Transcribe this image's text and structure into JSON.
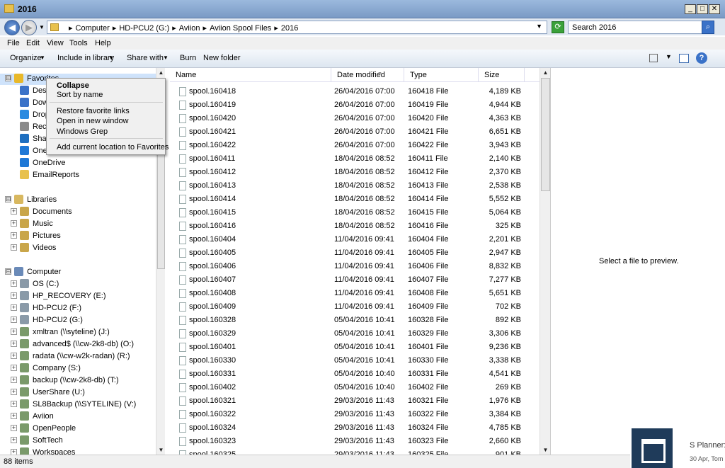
{
  "window": {
    "title": "2016"
  },
  "address": {
    "crumbs": [
      "Computer",
      "HD-PCU2 (G:)",
      "Aviion",
      "Aviion Spool Files",
      "2016"
    ],
    "search_placeholder": "Search 2016"
  },
  "menu": [
    "File",
    "Edit",
    "View",
    "Tools",
    "Help"
  ],
  "toolbar": [
    "Organize",
    "Include in library",
    "Share with",
    "Burn",
    "New folder"
  ],
  "nav": {
    "favorites": {
      "label": "Favorites",
      "items": [
        "Desktop",
        "Downloads",
        "Dropbox",
        "Recent Places",
        "SharePoint",
        "OneDrive",
        "OneDrive",
        "EmailReports"
      ]
    },
    "libraries": {
      "label": "Libraries",
      "items": [
        "Documents",
        "Music",
        "Pictures",
        "Videos"
      ]
    },
    "computer": {
      "label": "Computer",
      "items": [
        "OS (C:)",
        "HP_RECOVERY (E:)",
        "HD-PCU2 (F:)",
        "HD-PCU2 (G:)",
        "xmltran (\\\\syteline) (J:)",
        "advanced$ (\\\\cw-2k8-db) (O:)",
        "radata (\\\\cw-w2k-radan) (R:)",
        "Company (S:)",
        "backup (\\\\cw-2k8-db) (T:)",
        "UserShare (U:)",
        "SL8Backup (\\\\SYTELINE) (V:)",
        "Aviion",
        "OpenPeople",
        "SoftTech",
        "Workspaces"
      ]
    }
  },
  "context_menu": [
    "Collapse",
    "Sort by name",
    "Restore favorite links",
    "Open in new window",
    "Windows Grep",
    "Add current location to Favorites"
  ],
  "columns": [
    "Name",
    "Date modified",
    "Type",
    "Size"
  ],
  "files": [
    {
      "name": "spool.160418",
      "date": "26/04/2016 07:00",
      "type": "160418 File",
      "size": "4,189 KB"
    },
    {
      "name": "spool.160419",
      "date": "26/04/2016 07:00",
      "type": "160419 File",
      "size": "4,944 KB"
    },
    {
      "name": "spool.160420",
      "date": "26/04/2016 07:00",
      "type": "160420 File",
      "size": "4,363 KB"
    },
    {
      "name": "spool.160421",
      "date": "26/04/2016 07:00",
      "type": "160421 File",
      "size": "6,651 KB"
    },
    {
      "name": "spool.160422",
      "date": "26/04/2016 07:00",
      "type": "160422 File",
      "size": "3,943 KB"
    },
    {
      "name": "spool.160411",
      "date": "18/04/2016 08:52",
      "type": "160411 File",
      "size": "2,140 KB"
    },
    {
      "name": "spool.160412",
      "date": "18/04/2016 08:52",
      "type": "160412 File",
      "size": "2,370 KB"
    },
    {
      "name": "spool.160413",
      "date": "18/04/2016 08:52",
      "type": "160413 File",
      "size": "2,538 KB"
    },
    {
      "name": "spool.160414",
      "date": "18/04/2016 08:52",
      "type": "160414 File",
      "size": "5,552 KB"
    },
    {
      "name": "spool.160415",
      "date": "18/04/2016 08:52",
      "type": "160415 File",
      "size": "5,064 KB"
    },
    {
      "name": "spool.160416",
      "date": "18/04/2016 08:52",
      "type": "160416 File",
      "size": "325 KB"
    },
    {
      "name": "spool.160404",
      "date": "11/04/2016 09:41",
      "type": "160404 File",
      "size": "2,201 KB"
    },
    {
      "name": "spool.160405",
      "date": "11/04/2016 09:41",
      "type": "160405 File",
      "size": "2,947 KB"
    },
    {
      "name": "spool.160406",
      "date": "11/04/2016 09:41",
      "type": "160406 File",
      "size": "8,832 KB"
    },
    {
      "name": "spool.160407",
      "date": "11/04/2016 09:41",
      "type": "160407 File",
      "size": "7,277 KB"
    },
    {
      "name": "spool.160408",
      "date": "11/04/2016 09:41",
      "type": "160408 File",
      "size": "5,651 KB"
    },
    {
      "name": "spool.160409",
      "date": "11/04/2016 09:41",
      "type": "160409 File",
      "size": "702 KB"
    },
    {
      "name": "spool.160328",
      "date": "05/04/2016 10:41",
      "type": "160328 File",
      "size": "892 KB"
    },
    {
      "name": "spool.160329",
      "date": "05/04/2016 10:41",
      "type": "160329 File",
      "size": "3,306 KB"
    },
    {
      "name": "spool.160401",
      "date": "05/04/2016 10:41",
      "type": "160401 File",
      "size": "9,236 KB"
    },
    {
      "name": "spool.160330",
      "date": "05/04/2016 10:41",
      "type": "160330 File",
      "size": "3,338 KB"
    },
    {
      "name": "spool.160331",
      "date": "05/04/2016 10:40",
      "type": "160331 File",
      "size": "4,541 KB"
    },
    {
      "name": "spool.160402",
      "date": "05/04/2016 10:40",
      "type": "160402 File",
      "size": "269 KB"
    },
    {
      "name": "spool.160321",
      "date": "29/03/2016 11:43",
      "type": "160321 File",
      "size": "1,976 KB"
    },
    {
      "name": "spool.160322",
      "date": "29/03/2016 11:43",
      "type": "160322 File",
      "size": "3,384 KB"
    },
    {
      "name": "spool.160324",
      "date": "29/03/2016 11:43",
      "type": "160324 File",
      "size": "4,785 KB"
    },
    {
      "name": "spool.160323",
      "date": "29/03/2016 11:43",
      "type": "160323 File",
      "size": "2,660 KB"
    },
    {
      "name": "spool.160325",
      "date": "29/03/2016 11:43",
      "type": "160325 File",
      "size": "901 KB"
    }
  ],
  "preview": {
    "text": "Select a file to preview."
  },
  "status": {
    "text": "88 items"
  },
  "notification": {
    "title": "S Planner:",
    "subtitle": "30 Apr, Tom"
  }
}
